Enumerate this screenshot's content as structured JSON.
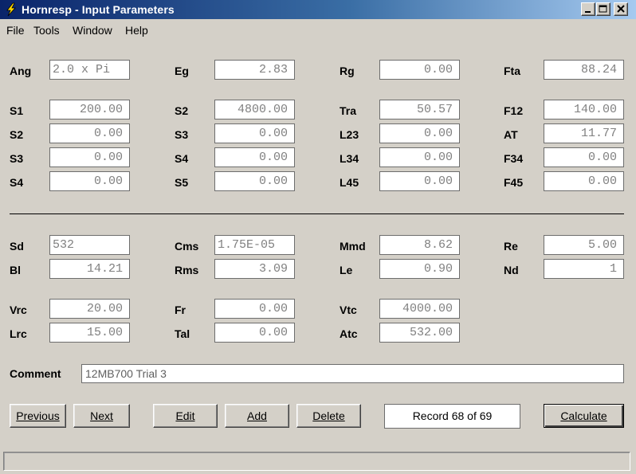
{
  "window": {
    "title": "Hornresp - Input Parameters"
  },
  "menu": {
    "items": [
      "File",
      "Tools",
      "Window",
      "Help"
    ]
  },
  "params": {
    "ang": {
      "label": "Ang",
      "value": "2.0 x Pi"
    },
    "eg": {
      "label": "Eg",
      "value": "2.83"
    },
    "rg": {
      "label": "Rg",
      "value": "0.00"
    },
    "fta": {
      "label": "Fta",
      "value": "88.24"
    },
    "s1": {
      "label": "S1",
      "value": "200.00"
    },
    "s2a": {
      "label": "S2",
      "value": "4800.00"
    },
    "tra": {
      "label": "Tra",
      "value": "50.57"
    },
    "f12": {
      "label": "F12",
      "value": "140.00"
    },
    "s2b": {
      "label": "S2",
      "value": "0.00"
    },
    "s3a": {
      "label": "S3",
      "value": "0.00"
    },
    "l23": {
      "label": "L23",
      "value": "0.00"
    },
    "at": {
      "label": "AT",
      "value": "11.77"
    },
    "s3b": {
      "label": "S3",
      "value": "0.00"
    },
    "s4a": {
      "label": "S4",
      "value": "0.00"
    },
    "l34": {
      "label": "L34",
      "value": "0.00"
    },
    "f34": {
      "label": "F34",
      "value": "0.00"
    },
    "s4b": {
      "label": "S4",
      "value": "0.00"
    },
    "s5": {
      "label": "S5",
      "value": "0.00"
    },
    "l45": {
      "label": "L45",
      "value": "0.00"
    },
    "f45": {
      "label": "F45",
      "value": "0.00"
    },
    "sd": {
      "label": "Sd",
      "value": "532"
    },
    "cms": {
      "label": "Cms",
      "value": "1.75E-05"
    },
    "mmd": {
      "label": "Mmd",
      "value": "8.62"
    },
    "re": {
      "label": "Re",
      "value": "5.00"
    },
    "bl": {
      "label": "Bl",
      "value": "14.21"
    },
    "rms": {
      "label": "Rms",
      "value": "3.09"
    },
    "le": {
      "label": "Le",
      "value": "0.90"
    },
    "nd": {
      "label": "Nd",
      "value": "1"
    },
    "vrc": {
      "label": "Vrc",
      "value": "20.00"
    },
    "fr": {
      "label": "Fr",
      "value": "0.00"
    },
    "vtc": {
      "label": "Vtc",
      "value": "4000.00"
    },
    "lrc": {
      "label": "Lrc",
      "value": "15.00"
    },
    "tal": {
      "label": "Tal",
      "value": "0.00"
    },
    "atc": {
      "label": "Atc",
      "value": "532.00"
    }
  },
  "comment": {
    "label": "Comment",
    "value": "12MB700 Trial 3"
  },
  "buttons": {
    "previous": "Previous",
    "next": "Next",
    "edit": "Edit",
    "add": "Add",
    "delete": "Delete",
    "calculate": "Calculate"
  },
  "record": "Record 68 of 69",
  "status": {
    "text": ""
  },
  "icons": {
    "app": "lightning-icon",
    "minimize": "minimize-icon",
    "maximize": "maximize-icon",
    "close": "close-icon"
  },
  "colors": {
    "title_bar_start": "#0a246a",
    "title_bar_end": "#a6caf0",
    "dialog_background": "#d4d0c8",
    "field_text": "#808080",
    "app_icon": "#ffd800"
  }
}
